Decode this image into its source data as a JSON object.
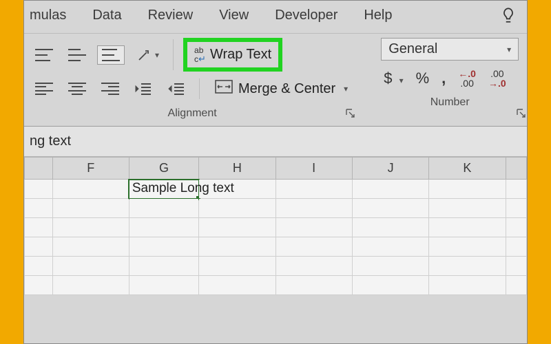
{
  "tabs": [
    "mulas",
    "Data",
    "Review",
    "View",
    "Developer",
    "Help"
  ],
  "ribbon": {
    "alignment": {
      "wrap_label": "Wrap Text",
      "merge_label": "Merge & Center",
      "group_label": "Alignment"
    },
    "number": {
      "format_selected": "General",
      "group_label": "Number",
      "currency": "$",
      "percent": "%",
      "comma": ",",
      "inc_dec": "←.0\n.00",
      "dec_dec": ".00\n→.0"
    }
  },
  "formula_bar": {
    "text": "ng text"
  },
  "grid": {
    "columns": [
      "",
      "F",
      "G",
      "H",
      "I",
      "J",
      "K",
      ""
    ],
    "selected_col_index": 2,
    "cell_value": "Sample Long text"
  }
}
